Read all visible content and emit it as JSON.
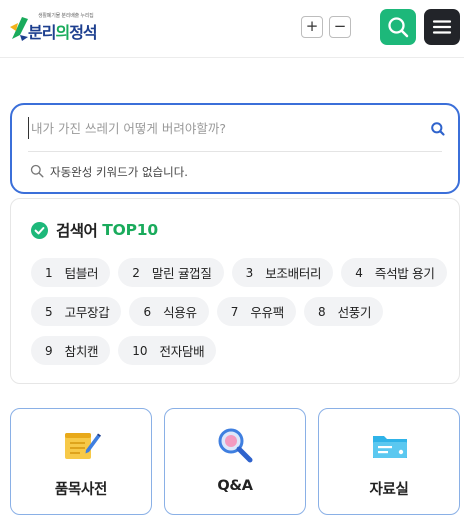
{
  "header": {
    "logo_tagline": "생활폐기물 분리배출 누리집",
    "logo_name_part1": "분리",
    "logo_name_part2": "의",
    "logo_name_part3": "정석",
    "zoom_in_label": "+",
    "zoom_out_label": "−",
    "search_icon": "search-icon",
    "menu_icon": "hamburger-menu-icon"
  },
  "search": {
    "placeholder": "내가 가진 쓰레기 어떻게 버려야할까?",
    "autocomplete_message": "자동완성 키워드가 없습니다."
  },
  "top10": {
    "title": "검색어",
    "title_accent": "TOP10",
    "items": [
      {
        "rank": "1",
        "word": "텀블러"
      },
      {
        "rank": "2",
        "word": "말린 귤껍질"
      },
      {
        "rank": "3",
        "word": "보조배터리"
      },
      {
        "rank": "4",
        "word": "즉석밥 용기"
      },
      {
        "rank": "5",
        "word": "고무장갑"
      },
      {
        "rank": "6",
        "word": "식용유"
      },
      {
        "rank": "7",
        "word": "우유팩"
      },
      {
        "rank": "8",
        "word": "선풍기"
      },
      {
        "rank": "9",
        "word": "참치캔"
      },
      {
        "rank": "10",
        "word": "전자담배"
      }
    ]
  },
  "quick_links": [
    {
      "label": "품목사전",
      "icon": "notepad-pencil-icon"
    },
    {
      "label": "Q&A",
      "icon": "magnifier-icon"
    },
    {
      "label": "자료실",
      "icon": "folder-icon"
    }
  ],
  "colors": {
    "brand_green": "#1db87a",
    "dark": "#222429",
    "search_border": "#3b6fd9",
    "card_border": "#8ab0e6"
  }
}
